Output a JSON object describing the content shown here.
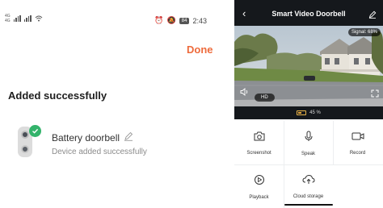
{
  "left": {
    "status": {
      "network_top": "4G",
      "network_bottom": "4G",
      "battery": "84",
      "time": "2:43"
    },
    "done_label": "Done",
    "title": "Added successfully",
    "device": {
      "name": "Battery doorbell",
      "subtitle": "Device added successfully"
    }
  },
  "right": {
    "title": "Smart Video Doorbell",
    "signal": "Signal: 68%",
    "quality": "HD",
    "battery_percent": "45 %",
    "battery_level": 0.45,
    "actions": [
      {
        "label": "Screenshot",
        "icon": "camera-icon"
      },
      {
        "label": "Speak",
        "icon": "microphone-icon"
      },
      {
        "label": "Record",
        "icon": "video-record-icon"
      },
      {
        "label": "Playback",
        "icon": "playback-icon"
      },
      {
        "label": "Cloud storage",
        "icon": "cloud-storage-icon"
      }
    ]
  },
  "colors": {
    "accent": "#ee6b3c",
    "success": "#33b36b",
    "dark_bar": "#15181c",
    "battery": "#e6a53a"
  }
}
